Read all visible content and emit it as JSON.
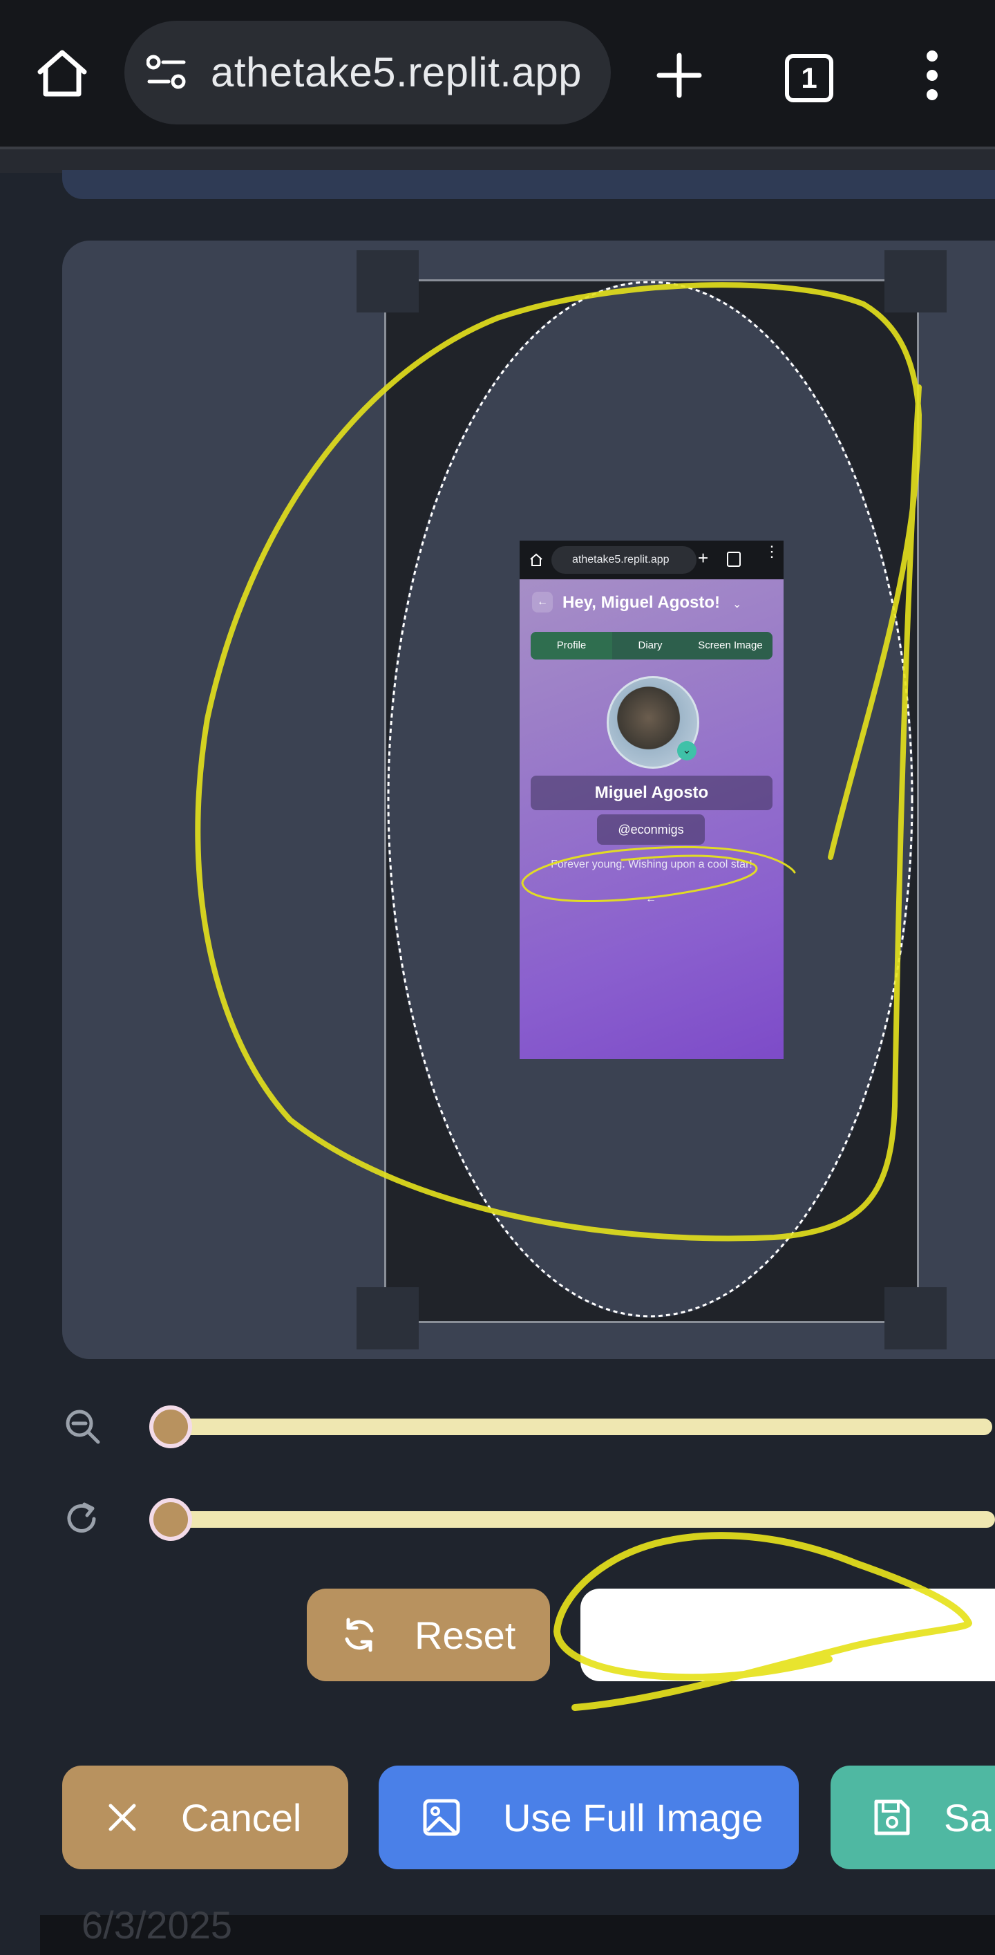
{
  "browser": {
    "url": "athetake5.replit.app",
    "tab_count": "1"
  },
  "preview": {
    "browser_url": "athetake5.replit.app",
    "greeting": "Hey, Miguel Agosto!",
    "tabs": [
      {
        "label": "Profile"
      },
      {
        "label": "Diary"
      },
      {
        "label": "Screen Image"
      }
    ],
    "name": "Miguel Agosto",
    "handle": "@econmigs",
    "bio": "Forever young. Wishing upon a cool star!"
  },
  "controls": {
    "zoom_value": 0,
    "rotate_value": 0,
    "reset_label": "Reset"
  },
  "actions": {
    "cancel_label": "Cancel",
    "full_image_label": "Use Full Image",
    "save_label": "Sa"
  },
  "footer": {
    "date": "6/3/2025"
  },
  "colors": {
    "accent_tan": "#b8925f",
    "accent_blue": "#4a80e8",
    "accent_teal": "#4fb8a2",
    "annotation_yellow": "#e6e21c"
  },
  "icons": [
    "home-icon",
    "site-settings-icon",
    "plus-icon",
    "tab-count-icon",
    "kebab-menu-icon",
    "zoom-out-icon",
    "rotate-icon",
    "refresh-icon",
    "close-icon",
    "image-icon",
    "save-icon"
  ]
}
